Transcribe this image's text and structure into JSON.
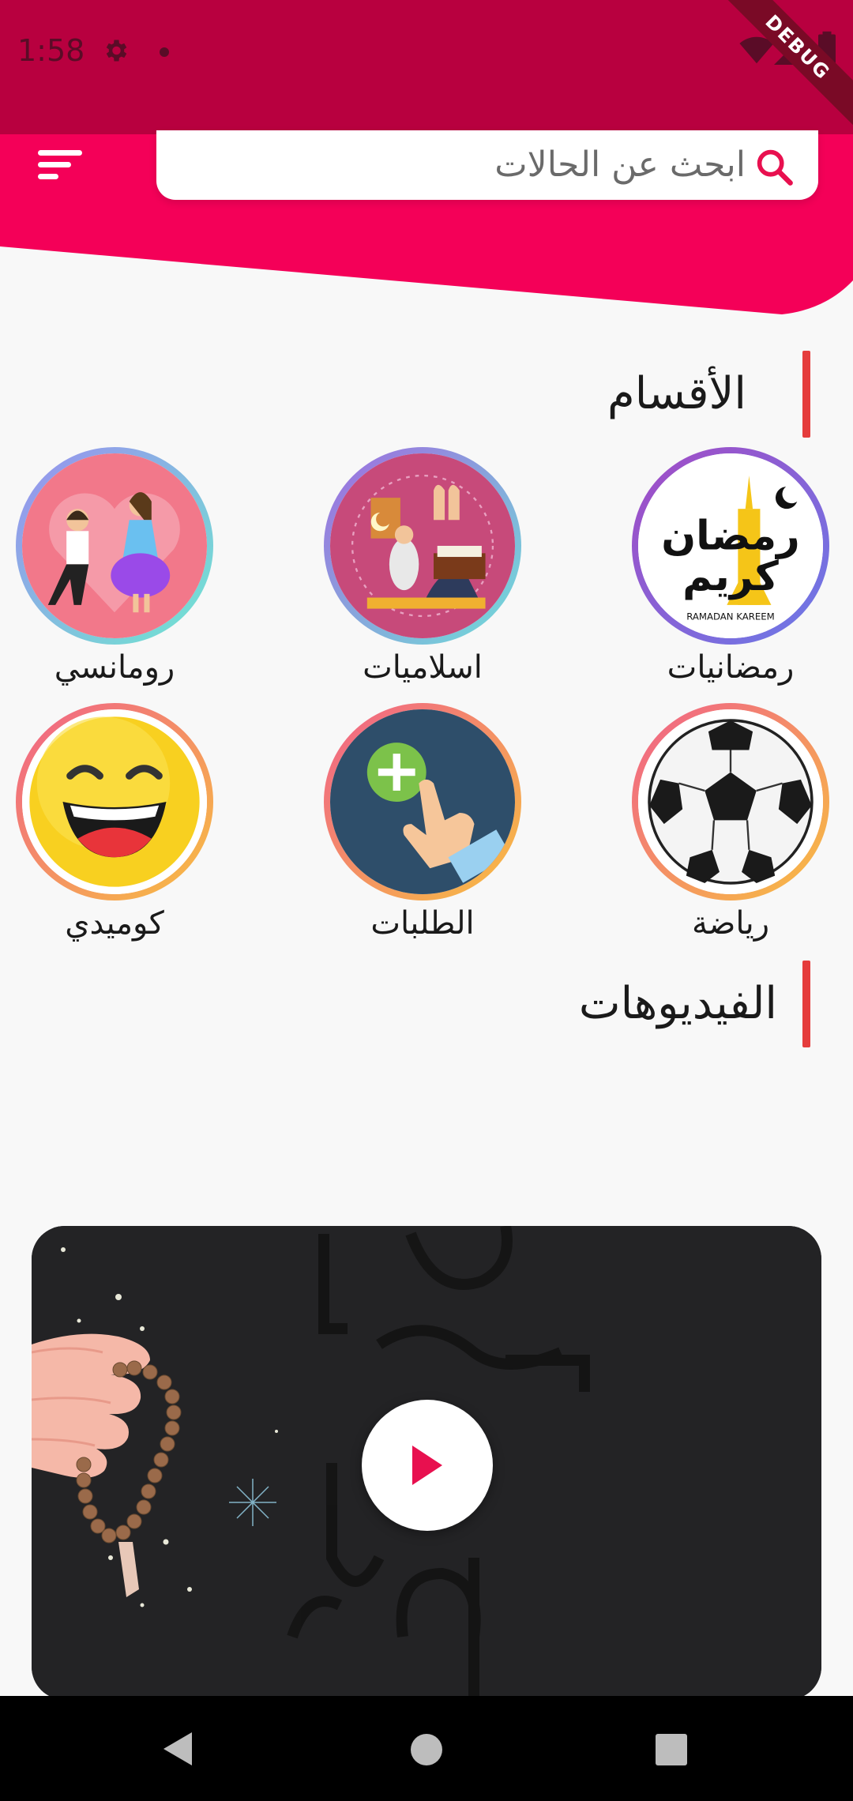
{
  "status_bar": {
    "time": "1:58",
    "debug_label": "DEBUG"
  },
  "header": {
    "search_placeholder": "ابحث عن الحالات"
  },
  "sections": {
    "categories_title": "الأقسام",
    "videos_title": "الفيديوهات"
  },
  "categories": [
    {
      "label": "رمضانيات",
      "icon": "ramadan-kareem-icon"
    },
    {
      "label": "اسلاميات",
      "icon": "islamic-prayer-icon"
    },
    {
      "label": "رومانسي",
      "icon": "romance-couple-icon"
    },
    {
      "label": "رياضة",
      "icon": "soccer-ball-icon"
    },
    {
      "label": "الطلبات",
      "icon": "add-request-icon"
    },
    {
      "label": "كوميدي",
      "icon": "laughing-emoji-icon"
    }
  ],
  "colors": {
    "status_bar": "#b8003f",
    "header": "#f40058",
    "accent_bar": "#e53c3c",
    "play_icon": "#e8104f"
  }
}
